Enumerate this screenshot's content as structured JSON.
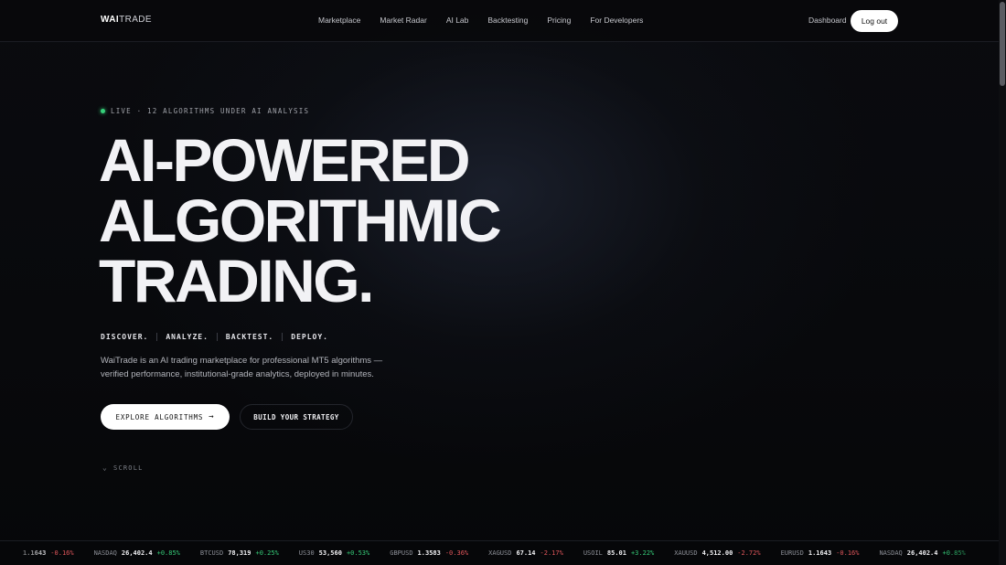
{
  "nav": {
    "logo_bold": "WAI",
    "logo_light": "TRADE",
    "links": [
      "Marketplace",
      "Market Radar",
      "AI Lab",
      "Backtesting",
      "Pricing",
      "For Developers"
    ],
    "dashboard": "Dashboard",
    "logout": "Log out"
  },
  "hero": {
    "live_label": "LIVE · 12 ALGORITHMS UNDER AI ANALYSIS",
    "headline": [
      "AI-POWERED",
      "ALGORITHMIC",
      "TRADING."
    ],
    "steps": [
      "DISCOVER.",
      "ANALYZE.",
      "BACKTEST.",
      "DEPLOY."
    ],
    "description": "WaiTrade is an AI trading marketplace for professional MT5 algorithms — verified performance, institutional-grade analytics, deployed in minutes.",
    "primary_button": "EXPLORE ALGORITHMS",
    "secondary_button": "BUILD YOUR STRATEGY",
    "scroll_label": "SCROLL"
  },
  "ticker": [
    {
      "symbol": "",
      "price": "1.1643",
      "change": "-0.16%",
      "direction": "down"
    },
    {
      "symbol": "NASDAQ",
      "price": "26,402.4",
      "change": "+0.85%",
      "direction": "up"
    },
    {
      "symbol": "BTCUSD",
      "price": "78,319",
      "change": "+0.25%",
      "direction": "up"
    },
    {
      "symbol": "US30",
      "price": "53,560",
      "change": "+0.53%",
      "direction": "up"
    },
    {
      "symbol": "GBPUSD",
      "price": "1.3583",
      "change": "-0.36%",
      "direction": "down"
    },
    {
      "symbol": "XAGUSD",
      "price": "67.14",
      "change": "-2.17%",
      "direction": "down"
    },
    {
      "symbol": "USOIL",
      "price": "85.01",
      "change": "+3.22%",
      "direction": "up"
    },
    {
      "symbol": "XAUUSD",
      "price": "4,512.00",
      "change": "-2.72%",
      "direction": "down"
    },
    {
      "symbol": "EURUSD",
      "price": "1.1643",
      "change": "-0.16%",
      "direction": "down"
    },
    {
      "symbol": "NASDAQ",
      "price": "26,402.4",
      "change": "+0.85%",
      "direction": "up"
    }
  ],
  "colors": {
    "background": "#060709",
    "accent_live": "#36d07a",
    "up": "#35c977",
    "down": "#e0565b"
  }
}
